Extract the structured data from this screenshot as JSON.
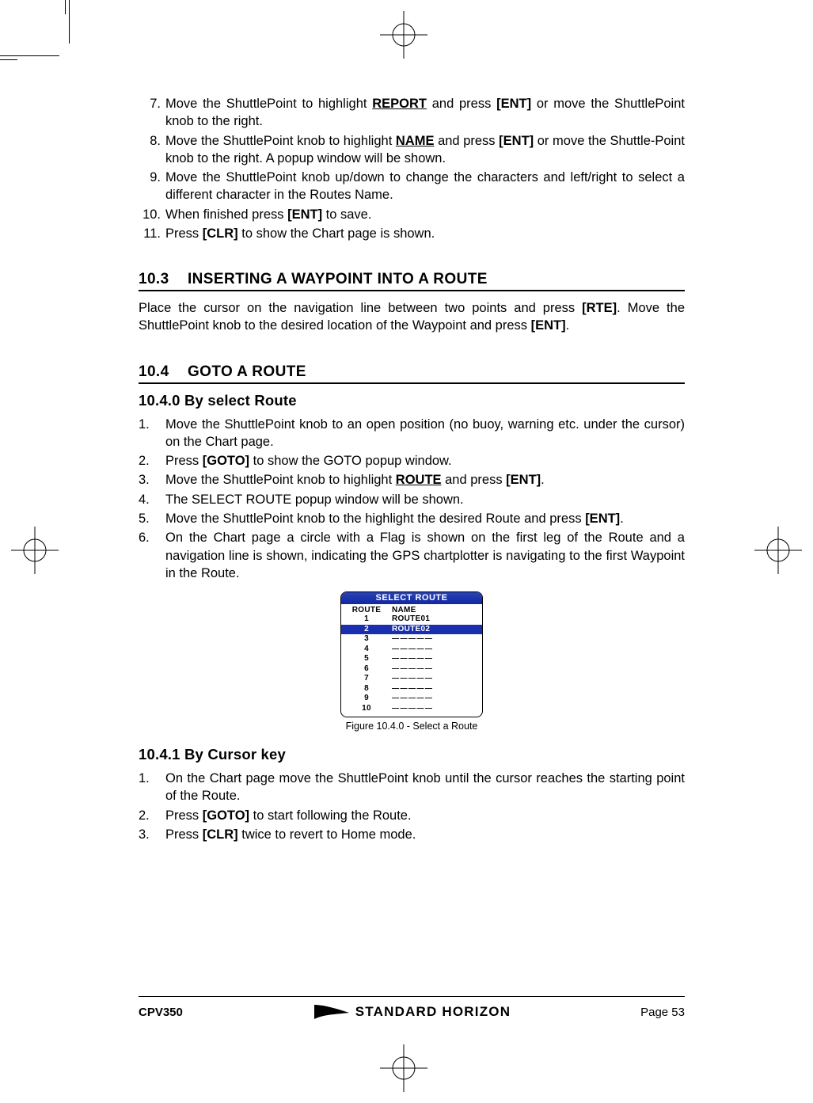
{
  "crop_marks": true,
  "topSteps": {
    "items": [
      {
        "num": "7.",
        "body_parts": [
          {
            "t": "Move the ShuttlePoint to highlight "
          },
          {
            "t": "REPORT",
            "b": true,
            "u": true
          },
          {
            "t": " and press "
          },
          {
            "t": "[ENT]",
            "b": true
          },
          {
            "t": " or move the ShuttlePoint knob to the right."
          }
        ]
      },
      {
        "num": "8.",
        "alignRight": true,
        "body_parts": [
          {
            "t": "Move the ShuttlePoint knob to highlight "
          },
          {
            "t": "NAME",
            "b": true,
            "u": true
          },
          {
            "t": " and press "
          },
          {
            "t": "[ENT]",
            "b": true
          },
          {
            "t": " or move the Shuttle-Point knob to the right. A popup window will be shown."
          }
        ]
      },
      {
        "num": "9.",
        "alignRight": true,
        "body_parts": [
          {
            "t": "Move the ShuttlePoint knob up/down to change the characters and left/right to select a different character in the Routes Name."
          }
        ]
      },
      {
        "num": "10.",
        "body_parts": [
          {
            "t": "When finished press "
          },
          {
            "t": "[ENT]",
            "b": true
          },
          {
            "t": " to save."
          }
        ]
      },
      {
        "num": "11.",
        "body_parts": [
          {
            "t": "Press "
          },
          {
            "t": "[CLR]",
            "b": true
          },
          {
            "t": " to show the Chart page is shown."
          }
        ]
      }
    ]
  },
  "section_10_3": {
    "num": "10.3",
    "title": "INSERTING A WAYPOINT INTO A ROUTE",
    "para_parts": [
      {
        "t": "Place the cursor on the navigation line between two points and press "
      },
      {
        "t": "[RTE]",
        "b": true
      },
      {
        "t": ". Move the ShuttlePoint knob to the desired location of the Waypoint and press "
      },
      {
        "t": "[ENT]",
        "b": true
      },
      {
        "t": "."
      }
    ]
  },
  "section_10_4": {
    "num": "10.4",
    "title": "GOTO A ROUTE"
  },
  "sub_10_4_0": {
    "title": "10.4.0  By select Route",
    "steps": [
      {
        "num": "1.",
        "parts": [
          {
            "t": "Move the ShuttlePoint knob to an open position (no buoy, warning etc. under the cursor) on the Chart page."
          }
        ]
      },
      {
        "num": "2.",
        "parts": [
          {
            "t": "Press "
          },
          {
            "t": "[GOTO]",
            "b": true
          },
          {
            "t": " to show the GOTO popup window."
          }
        ]
      },
      {
        "num": "3.",
        "parts": [
          {
            "t": "Move the ShuttlePoint knob to highlight "
          },
          {
            "t": "ROUTE",
            "b": true,
            "u": true
          },
          {
            "t": " and press "
          },
          {
            "t": "[ENT]",
            "b": true
          },
          {
            "t": "."
          }
        ]
      },
      {
        "num": "4.",
        "parts": [
          {
            "t": "The SELECT ROUTE popup window will be shown."
          }
        ]
      },
      {
        "num": "5.",
        "parts": [
          {
            "t": "Move the ShuttlePoint knob to the highlight the desired Route and press "
          },
          {
            "t": "[ENT]",
            "b": true
          },
          {
            "t": "."
          }
        ]
      },
      {
        "num": "6.",
        "parts": [
          {
            "t": "On the Chart page a circle with a Flag is shown on the first leg of the Route and a navigation line is shown, indicating the GPS chartplotter is navigating to the first Waypoint in the Route."
          }
        ]
      }
    ]
  },
  "figure": {
    "title": "SELECT ROUTE",
    "col1": "ROUTE",
    "col2": "NAME",
    "rows": [
      {
        "n": "1",
        "name": "ROUTE01",
        "hl": false
      },
      {
        "n": "2",
        "name": "ROUTE02",
        "hl": true
      },
      {
        "n": "3",
        "name": "",
        "hl": false
      },
      {
        "n": "4",
        "name": "",
        "hl": false
      },
      {
        "n": "5",
        "name": "",
        "hl": false
      },
      {
        "n": "6",
        "name": "",
        "hl": false
      },
      {
        "n": "7",
        "name": "",
        "hl": false
      },
      {
        "n": "8",
        "name": "",
        "hl": false
      },
      {
        "n": "9",
        "name": "",
        "hl": false
      },
      {
        "n": "10",
        "name": "",
        "hl": false
      }
    ],
    "caption": "Figure 10.4.0 -  Select a Route"
  },
  "sub_10_4_1": {
    "title": "10.4.1  By Cursor key",
    "steps": [
      {
        "num": "1.",
        "parts": [
          {
            "t": "On the Chart page move the ShuttlePoint knob until the cursor reaches the starting point of the Route."
          }
        ]
      },
      {
        "num": "2.",
        "parts": [
          {
            "t": "Press "
          },
          {
            "t": "[GOTO]",
            "b": true
          },
          {
            "t": " to start following the Route."
          }
        ]
      },
      {
        "num": "3.",
        "parts": [
          {
            "t": "Press "
          },
          {
            "t": "[CLR]",
            "b": true
          },
          {
            "t": " twice to revert to Home mode."
          }
        ]
      }
    ]
  },
  "footer": {
    "left": "CPV350",
    "brand": "STANDARD HORIZON",
    "right": "Page 53"
  }
}
